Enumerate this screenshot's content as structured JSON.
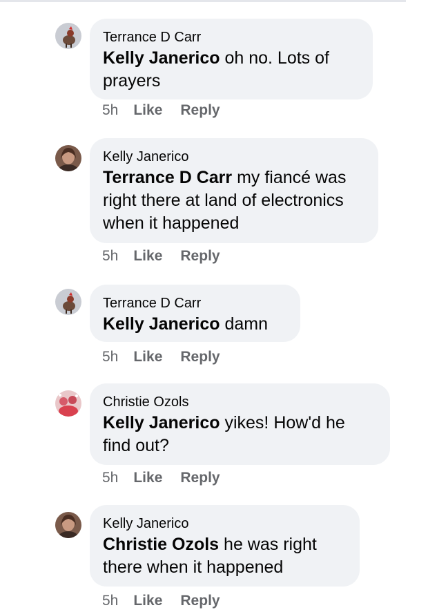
{
  "comments": [
    {
      "author": "Terrance D Carr",
      "mention": "Kelly Janerico",
      "text": " oh no. Lots of prayers",
      "time": "5h",
      "like_label": "Like",
      "reply_label": "Reply",
      "avatar_icon": "rooster-avatar"
    },
    {
      "author": "Kelly Janerico",
      "mention": "Terrance D Carr",
      "text": "  my fiancé was right there at land of electronics when it happened",
      "time": "5h",
      "like_label": "Like",
      "reply_label": "Reply",
      "avatar_icon": "woman-portrait-avatar"
    },
    {
      "author": "Terrance D Carr",
      "mention": "Kelly Janerico",
      "text": " damn",
      "time": "5h",
      "like_label": "Like",
      "reply_label": "Reply",
      "avatar_icon": "rooster-avatar"
    },
    {
      "author": "Christie Ozols",
      "mention": "Kelly Janerico",
      "text": " yikes! How'd he find out?",
      "time": "5h",
      "like_label": "Like",
      "reply_label": "Reply",
      "avatar_icon": "pink-group-avatar"
    },
    {
      "author": "Kelly Janerico",
      "mention": "Christie Ozols",
      "text": " he was right there when it happened",
      "time": "5h",
      "like_label": "Like",
      "reply_label": "Reply",
      "avatar_icon": "woman-portrait-avatar"
    }
  ]
}
